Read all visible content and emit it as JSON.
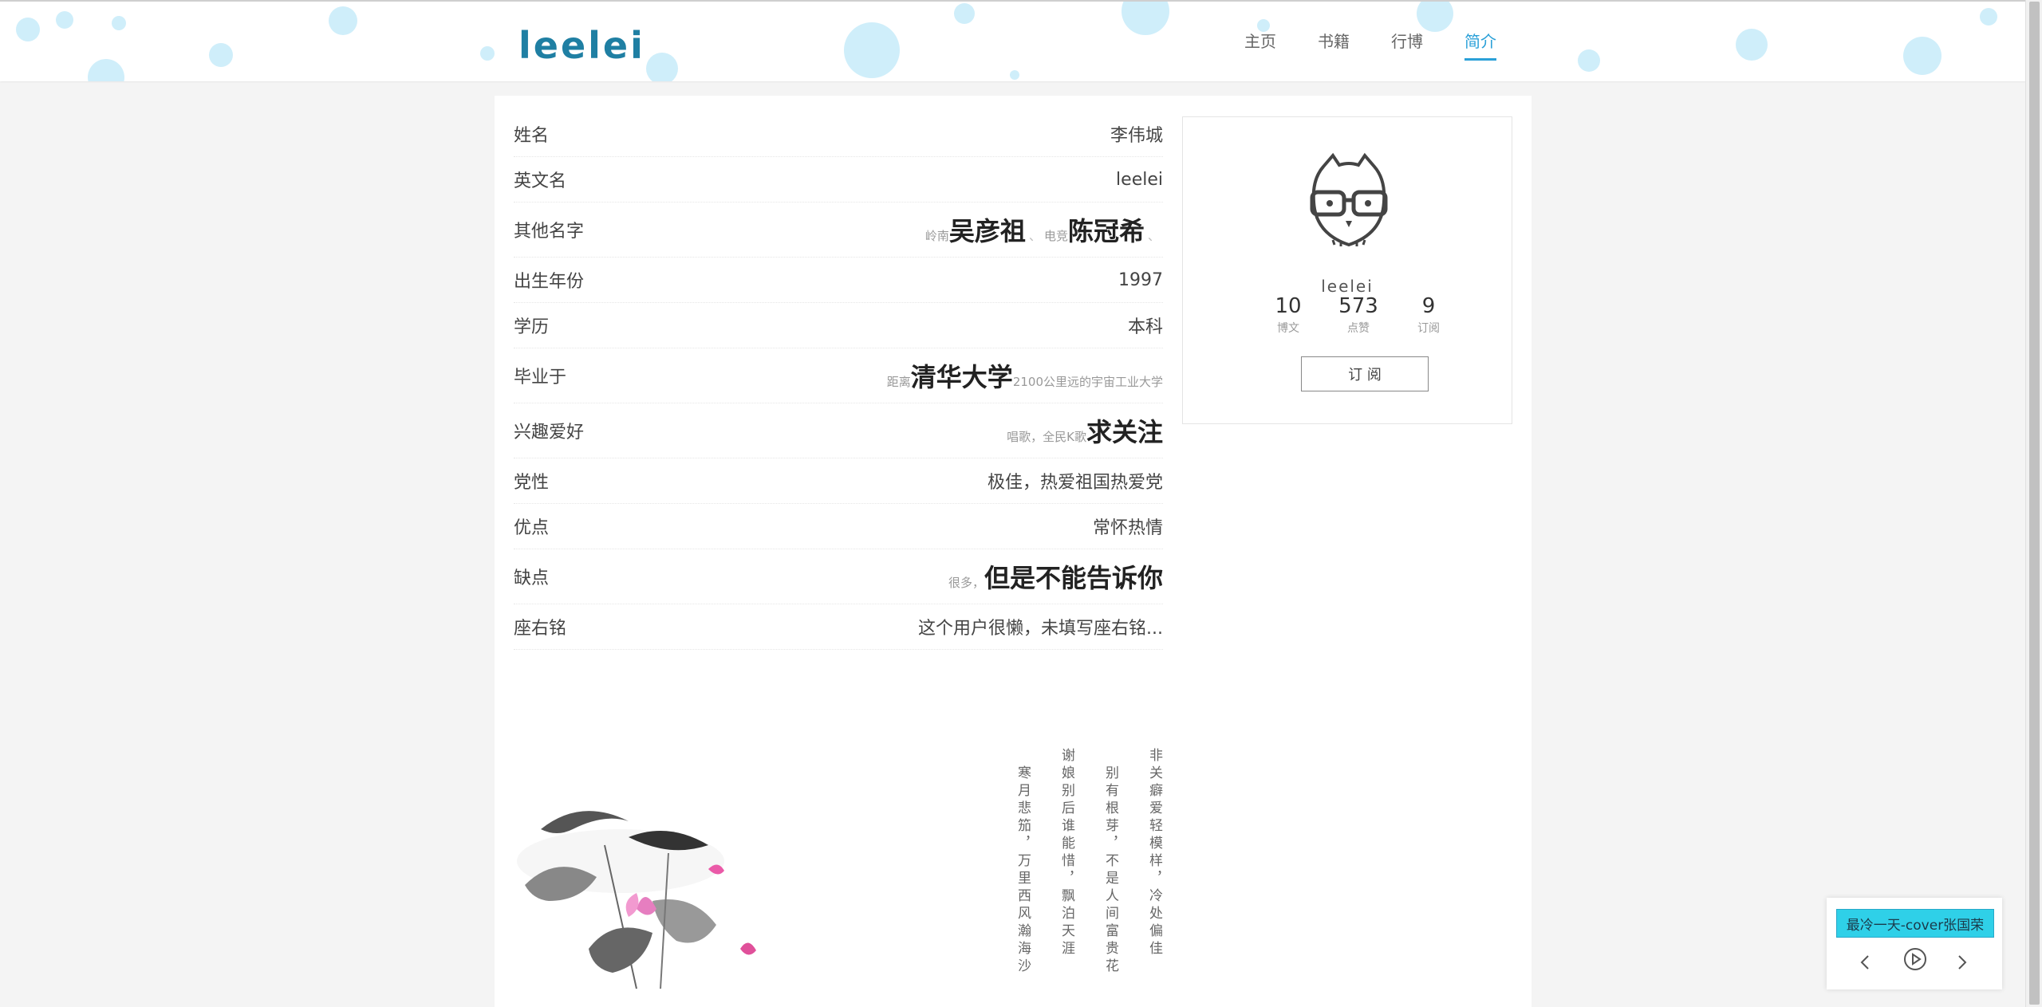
{
  "header": {
    "logo": "leelei",
    "nav": [
      {
        "label": "主页",
        "active": false
      },
      {
        "label": "书籍",
        "active": false
      },
      {
        "label": "行博",
        "active": false
      },
      {
        "label": "简介",
        "active": true
      }
    ]
  },
  "profile_info": {
    "rows": [
      {
        "label": "姓名",
        "value": "李伟城"
      },
      {
        "label": "英文名",
        "value": "leelei"
      },
      {
        "label": "其他名字",
        "small1": "岭南",
        "big1": "吴彦祖",
        "sep1": "、",
        "small2": "电竞",
        "big2": "陈冠希",
        "sep2": "、"
      },
      {
        "label": "出生年份",
        "value": "1997"
      },
      {
        "label": "学历",
        "value": "本科"
      },
      {
        "label": "毕业于",
        "small1": "距离",
        "big1": "清华大学",
        "small2": "2100公里远的宇宙工业大学"
      },
      {
        "label": "兴趣爱好",
        "small1": "唱歌，全民K歌",
        "big1": "求关注"
      },
      {
        "label": "党性",
        "value": "极佳，热爱祖国热爱党"
      },
      {
        "label": "优点",
        "value": "常怀热情"
      },
      {
        "label": "缺点",
        "small1": "很多，",
        "big1": "但是不能告诉你"
      },
      {
        "label": "座右铭",
        "value": "这个用户很懒，未填写座右铭..."
      }
    ]
  },
  "profile_card": {
    "username": "leelei",
    "stats": [
      {
        "num": "10",
        "caption": "博文"
      },
      {
        "num": "573",
        "caption": "点赞"
      },
      {
        "num": "9",
        "caption": "订阅"
      }
    ],
    "subscribe_label": "订 阅"
  },
  "poem": {
    "columns": [
      "非关癖爱轻模样，冷处偏佳",
      "别有根芽，不是人间富贵花",
      "谢娘别后谁能惜，飘泊天涯",
      "寒月悲笳，万里西风瀚海沙"
    ]
  },
  "player": {
    "track": "最冷一天-cover张国荣"
  },
  "colors": {
    "accent": "#2aa0d8",
    "logo": "#1f7fa3",
    "bubble": "#cfeefa",
    "track_bg": "#2fd0e8"
  }
}
